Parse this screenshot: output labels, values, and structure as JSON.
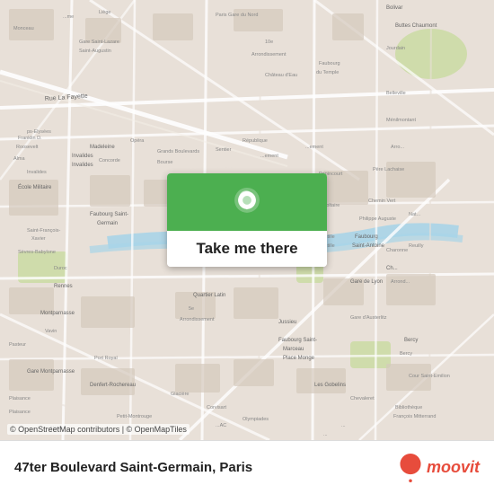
{
  "map": {
    "attribution": "© OpenStreetMap contributors | © OpenMapTiles"
  },
  "button": {
    "label": "Take me there",
    "pin_icon": "location-pin"
  },
  "bottom_bar": {
    "location": "47ter Boulevard Saint-Germain, Paris"
  },
  "moovit": {
    "label": "moovit"
  }
}
